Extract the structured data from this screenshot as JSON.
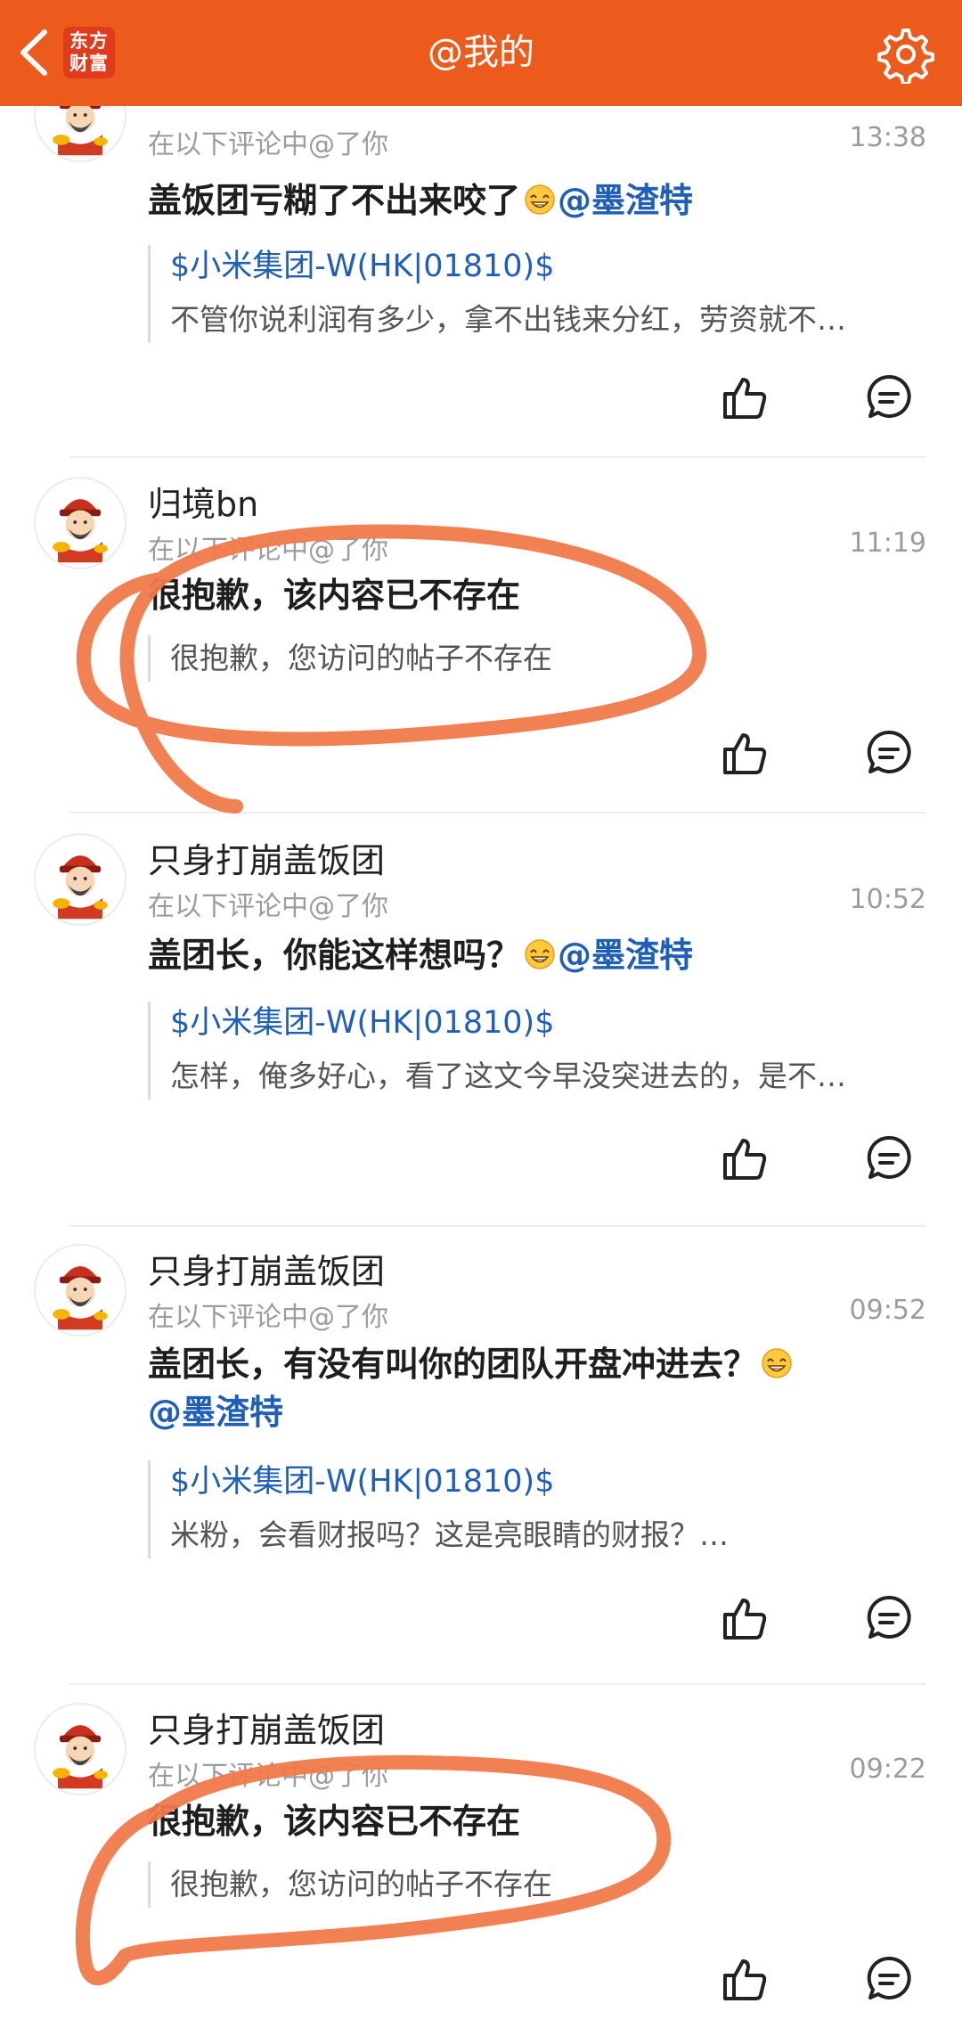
{
  "header": {
    "title": "@我的",
    "logo_line1": "东方",
    "logo_line2": "财富"
  },
  "comments": [
    {
      "username": "",
      "meta": "在以下评论中@了你",
      "time": "13:38",
      "content": "盖饭团亏糊了不出来咬了",
      "mention": "@墨渣特",
      "quote_stock": "$小米集团-W(HK|01810)$",
      "quote_text": "不管你说利润有多少，拿不出钱来分红，劳资就不…"
    },
    {
      "username": "归境bn",
      "meta": "在以下评论中@了你",
      "time": "11:19",
      "content": "很抱歉，该内容已不存在",
      "quote_text": "很抱歉，您访问的帖子不存在"
    },
    {
      "username": "只身打崩盖饭团",
      "meta": "在以下评论中@了你",
      "time": "10:52",
      "content": "盖团长，你能这样想吗？",
      "mention": "@墨渣特",
      "quote_stock": "$小米集团-W(HK|01810)$",
      "quote_text": "怎样，俺多好心，看了这文今早没突进去的，是不…"
    },
    {
      "username": "只身打崩盖饭团",
      "meta": "在以下评论中@了你",
      "time": "09:52",
      "content": "盖团长，有没有叫你的团队开盘冲进去？",
      "mention": "@墨渣特",
      "quote_stock": "$小米集团-W(HK|01810)$",
      "quote_text": "米粉，会看财报吗？这是亮眼睛的财报？…"
    },
    {
      "username": "只身打崩盖饭团",
      "meta": "在以下评论中@了你",
      "time": "09:22",
      "content": "很抱歉，该内容已不存在",
      "quote_text": "很抱歉，您访问的帖子不存在"
    }
  ],
  "icons": {
    "back": "chevron-left-icon",
    "settings": "gear-icon",
    "like": "thumbs-up-icon",
    "comment": "comment-bubble-icon"
  },
  "colors": {
    "header_bg": "#ec5b1b",
    "mention": "#1f5fb8",
    "annotation": "#f07a4a"
  }
}
